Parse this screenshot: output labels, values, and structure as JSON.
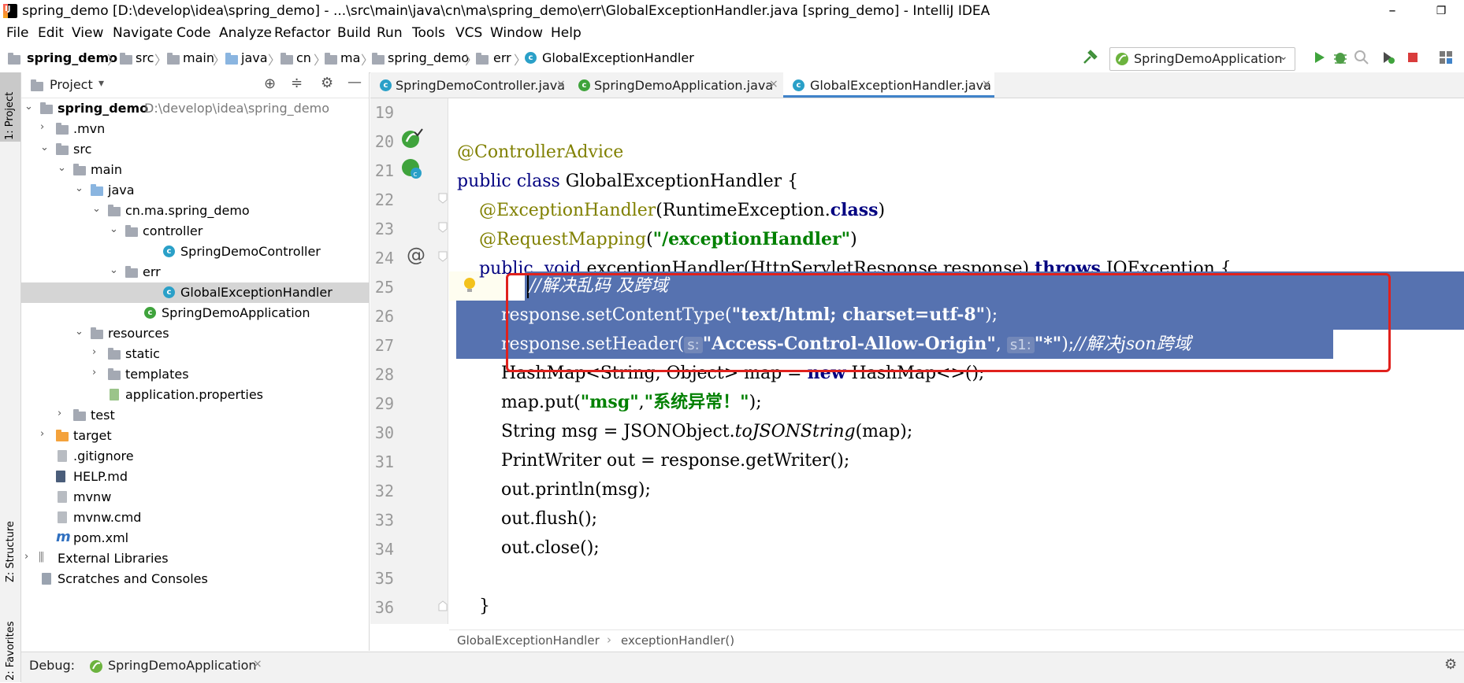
{
  "window": {
    "title": "spring_demo [D:\\develop\\idea\\spring_demo] - ...\\src\\main\\java\\cn\\ma\\spring_demo\\err\\GlobalExceptionHandler.java [spring_demo] - IntelliJ IDEA",
    "minimize": "–",
    "maximize": "❐"
  },
  "menu": [
    "File",
    "Edit",
    "View",
    "Navigate",
    "Code",
    "Analyze",
    "Refactor",
    "Build",
    "Run",
    "Tools",
    "VCS",
    "Window",
    "Help"
  ],
  "navbar": {
    "crumbs": [
      "spring_demo",
      "src",
      "main",
      "java",
      "cn",
      "ma",
      "spring_demo",
      "err",
      "GlobalExceptionHandler"
    ],
    "run_config": "SpringDemoApplication"
  },
  "left_strip": {
    "project": "1: Project",
    "structure": "Z: Structure",
    "favorites": "2: Favorites"
  },
  "project": {
    "title": "Project",
    "tree": [
      {
        "label": "spring_demo",
        "path": "D:\\develop\\idea\\spring_demo",
        "arrow": "⌄"
      },
      {
        "label": ".mvn",
        "arrow": "›"
      },
      {
        "label": "src",
        "arrow": "⌄"
      },
      {
        "label": "main",
        "arrow": "⌄"
      },
      {
        "label": "java",
        "arrow": "⌄"
      },
      {
        "label": "cn.ma.spring_demo",
        "arrow": "⌄"
      },
      {
        "label": "controller",
        "arrow": "⌄"
      },
      {
        "label": "SpringDemoController"
      },
      {
        "label": "err",
        "arrow": "⌄"
      },
      {
        "label": "GlobalExceptionHandler"
      },
      {
        "label": "SpringDemoApplication"
      },
      {
        "label": "resources",
        "arrow": "⌄"
      },
      {
        "label": "static",
        "arrow": "›"
      },
      {
        "label": "templates",
        "arrow": "›"
      },
      {
        "label": "application.properties"
      },
      {
        "label": "test",
        "arrow": "›"
      },
      {
        "label": "target",
        "arrow": "›"
      },
      {
        "label": ".gitignore"
      },
      {
        "label": "HELP.md"
      },
      {
        "label": "mvnw"
      },
      {
        "label": "mvnw.cmd"
      },
      {
        "label": "pom.xml"
      },
      {
        "label": "External Libraries",
        "arrow": "›"
      },
      {
        "label": "Scratches and Consoles"
      }
    ]
  },
  "tabs": [
    {
      "label": "SpringDemoController.java",
      "close": "×"
    },
    {
      "label": "SpringDemoApplication.java",
      "close": "×"
    },
    {
      "label": "GlobalExceptionHandler.java",
      "close": "×"
    }
  ],
  "editor": {
    "line_numbers": [
      "19",
      "20",
      "21",
      "22",
      "23",
      "24",
      "25",
      "26",
      "27",
      "28",
      "29",
      "30",
      "31",
      "32",
      "33",
      "34",
      "35",
      "36"
    ],
    "hint_s": "s:",
    "hint_s1": "s1:"
  },
  "code_breadcrumb": [
    "GlobalExceptionHandler",
    "exceptionHandler()"
  ],
  "bottom": {
    "debug_label": "Debug:",
    "debug_tab": "SpringDemoApplication",
    "close": "×"
  },
  "colors": {
    "selection": "#5672b0",
    "accent": "#4083c9",
    "annotation_box": "#e0211d"
  }
}
